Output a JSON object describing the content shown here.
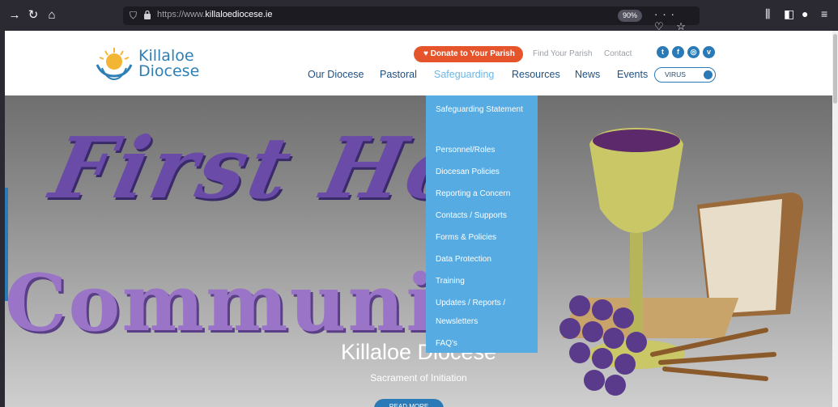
{
  "browser": {
    "url_prefix": "https://www.",
    "url_domain": "killaloediocese.ie",
    "zoom": "90%",
    "url_icons": "··· ♡ ☆",
    "toolbar_icons": {
      "back": "→",
      "reload": "↻",
      "home": "⌂",
      "library": "⫼",
      "sidebar": "◧",
      "account": "●",
      "menu": "≡"
    }
  },
  "header": {
    "logo_line1": "Killaloe",
    "logo_line2": "Diocese",
    "donate_label": "♥ Donate to Your Parish",
    "utility_links": [
      "Find Your Parish",
      "Contact"
    ],
    "social": [
      "t",
      "f",
      "◎",
      "v"
    ],
    "nav": [
      "Our Diocese",
      "Pastoral",
      "Safeguarding",
      "Resources",
      "News",
      "Events"
    ],
    "search_placeholder": "VIRUS"
  },
  "hero": {
    "word1": "First Ho",
    "word2": "Communi",
    "title": "Killaloe Diocese",
    "subtitle": "Sacrament of Initiation",
    "button": "READ MORE"
  },
  "dropdown": {
    "items": [
      "Safeguarding Statement",
      "Personnel/Roles",
      "Diocesan Policies",
      "Reporting a Concern",
      "Contacts / Supports",
      "Forms & Policies",
      "Data Protection",
      "Training",
      "Updates / Reports / Newsletters",
      "FAQ's"
    ]
  },
  "colors": {
    "accent": "#2a7ab8",
    "donate": "#e5542b",
    "dropdown": "#56abe2",
    "nav": "#1f4f82"
  }
}
